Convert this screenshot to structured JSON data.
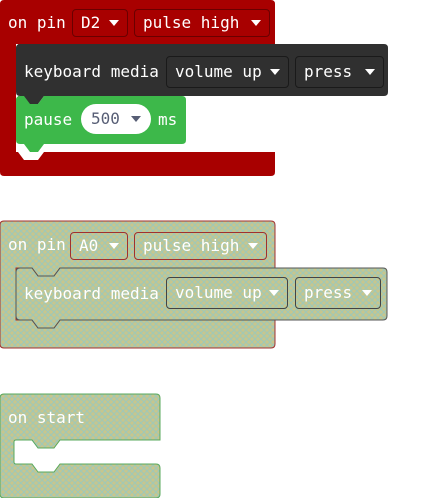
{
  "blocks": {
    "first": {
      "hat_label": "on pin",
      "pin": "D2",
      "pulse": "pulse high",
      "keyboard_label": "keyboard media",
      "media_action": "volume up",
      "key_event": "press",
      "pause_label": "pause",
      "pause_value": "500",
      "pause_unit": "ms"
    },
    "second": {
      "hat_label": "on pin",
      "pin": "A0",
      "pulse": "pulse high",
      "keyboard_label": "keyboard media",
      "media_action": "volume up",
      "key_event": "press"
    },
    "third": {
      "hat_label": "on start"
    }
  },
  "colors": {
    "pin_event_red": "#a80000",
    "keyboard_dark": "#303030",
    "pause_green": "#3db84a",
    "disabled_fill": "#c9c89a",
    "disabled_hatch": "#a9c7ad",
    "disabled_border": "#a03030",
    "on_start_border": "#58a85c"
  }
}
